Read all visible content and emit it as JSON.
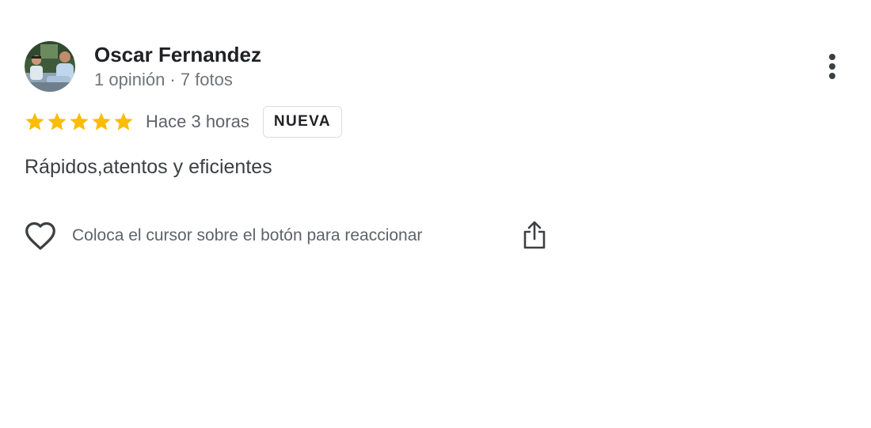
{
  "review": {
    "author": {
      "name": "Oscar Fernandez",
      "meta": "1 opinión · 7 fotos",
      "avatar_icon": "user-photo-avatar"
    },
    "rating": {
      "stars": 5,
      "max_stars": 5,
      "star_color": "#fbbc04"
    },
    "time": "Hace 3 horas",
    "badge": "NUEVA",
    "text": "Rápidos,atentos y eficientes",
    "actions": {
      "like_icon": "heart-outline-icon",
      "reaction_hint": "Coloca el cursor sobre el botón para reaccionar",
      "share_icon": "share-icon",
      "more_icon": "more-vertical-icon"
    }
  }
}
